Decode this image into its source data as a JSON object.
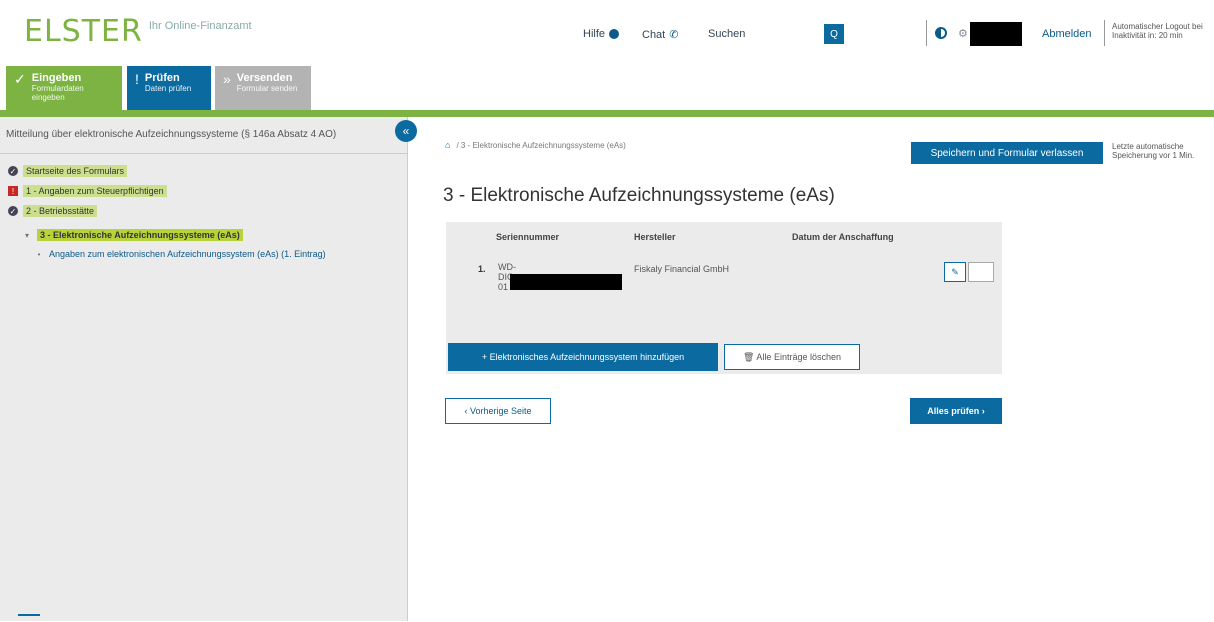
{
  "header": {
    "logo": "ELSTER",
    "logo_sub": "Ihr Online-Finanzamt",
    "help": "Hilfe",
    "contact": "Chat",
    "search": "Suchen",
    "search_button": "Q",
    "logout": "Abmelden",
    "auto_logout": "Automatischer Logout bei Inaktivität in: 20 min"
  },
  "steps": [
    {
      "label": "Eingeben",
      "sub": "Formulardaten eingeben",
      "icon": "✓"
    },
    {
      "label": "Prüfen",
      "sub": "Daten prüfen",
      "icon": "!"
    },
    {
      "label": "Versenden",
      "sub": "Formular senden",
      "icon": "»"
    }
  ],
  "toolbar": {
    "save": "Speichern und Formular verlassen",
    "auto_save": "Letzte automatische Speicherung vor 1 Min."
  },
  "sidebar": {
    "title": "Mitteilung über elektronische Aufzeichnungssysteme (§ 146a Absatz 4 AO)",
    "items": [
      {
        "label": "Startseite des Formulars",
        "status": "✓"
      },
      {
        "label": "1 - Angaben zum Steuerpflichtigen",
        "status": "!"
      },
      {
        "label": "2 - Betriebsstätte",
        "status": "✓"
      },
      {
        "label": "3 - Elektronische Aufzeichnungssysteme (eAs)",
        "status": "▾"
      },
      {
        "label": "Angaben zum elektronischen Aufzeichnungssystem (eAs) (1. Eintrag)",
        "status": "•"
      }
    ],
    "collapse": "«"
  },
  "main": {
    "breadcrumb_home": "⌂",
    "breadcrumb": "/ 3 - Elektronische Aufzeichnungssysteme (eAs)",
    "title": "3 - Elektronische Aufzeichnungssysteme (eAs)",
    "columns": [
      "Seriennummer",
      "Hersteller",
      "Datum der Anschaffung"
    ],
    "rows": [
      {
        "num": "1.",
        "serial_a": "WD-",
        "serial_b": "DIG",
        "serial_c": "01",
        "maker": "Fiskaly Financial GmbH",
        "date": ""
      }
    ],
    "edit": "✎",
    "add": "+ Elektronisches Aufzeichnungssystem hinzufügen",
    "delete_all": "🗑 Alle Einträge löschen",
    "prev": "‹ Vorherige Seite",
    "check_all": "Alles prüfen ›"
  }
}
